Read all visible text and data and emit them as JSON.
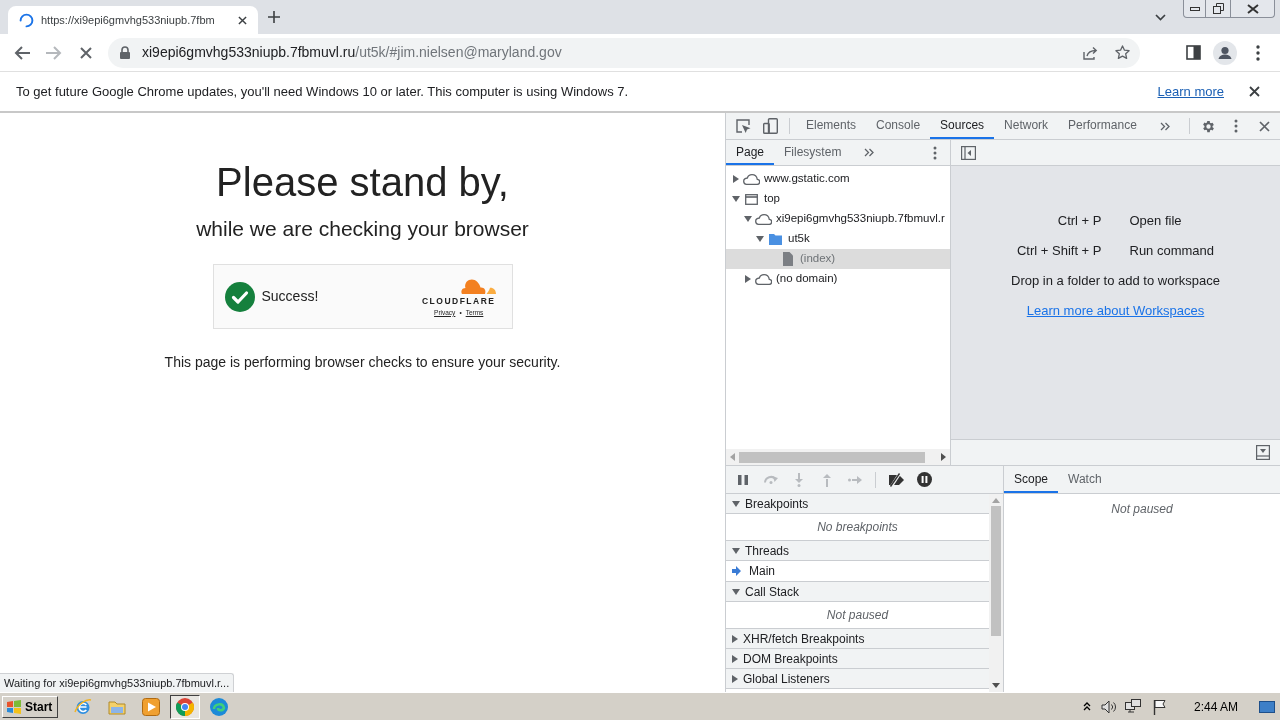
{
  "browser": {
    "tab": {
      "title": "https://xi9epi6gmvhg533niupb.7fbm",
      "loading": true
    },
    "nav_buttons": [
      {
        "kind": "back",
        "disabled": false
      },
      {
        "kind": "forward",
        "disabled": true
      },
      {
        "kind": "stop",
        "disabled": false
      }
    ],
    "address_bar": {
      "host": "xi9epi6gmvhg533niupb.7fbmuvl.ru",
      "path": "/ut5k/#jim.nielsen@maryland.gov"
    },
    "infobar": {
      "message": "To get future Google Chrome updates, you'll need Windows 10 or later. This computer is using Windows 7.",
      "link": "Learn more"
    },
    "status_bubble": "Waiting for xi9epi6gmvhg533niupb.7fbmuvl.r..."
  },
  "page": {
    "heading": "Please stand by,",
    "subheading": "while we are checking your browser",
    "widget": {
      "status": "Success!",
      "brand": "CLOUDFLARE",
      "links": [
        "Privacy",
        "Terms"
      ],
      "separator": "•"
    },
    "note": "This page is performing browser checks to ensure your security."
  },
  "devtools": {
    "tabs": [
      {
        "label": "Elements",
        "selected": false
      },
      {
        "label": "Console",
        "selected": false
      },
      {
        "label": "Sources",
        "selected": true
      },
      {
        "label": "Network",
        "selected": false
      },
      {
        "label": "Performance",
        "selected": false
      }
    ],
    "navigator": {
      "tabs": [
        {
          "label": "Page",
          "selected": true
        },
        {
          "label": "Filesystem",
          "selected": false
        }
      ],
      "tree": [
        {
          "label": "www.gstatic.com",
          "kind": "domain",
          "expanded": false,
          "selected": false
        },
        {
          "label": "top",
          "kind": "frame",
          "expanded": true,
          "selected": false,
          "children": [
            {
              "label": "xi9epi6gmvhg533niupb.7fbmuvl.r",
              "kind": "domain",
              "expanded": true,
              "selected": false,
              "children": [
                {
                  "label": "ut5k",
                  "kind": "folder",
                  "expanded": true,
                  "selected": false,
                  "children": [
                    {
                      "label": "(index)",
                      "kind": "file",
                      "selected": true
                    }
                  ]
                }
              ]
            },
            {
              "label": "(no domain)",
              "kind": "domain",
              "expanded": false,
              "selected": false
            }
          ]
        }
      ]
    },
    "editor": {
      "shortcuts": [
        {
          "keys": "Ctrl + P",
          "action": "Open file"
        },
        {
          "keys": "Ctrl + Shift + P",
          "action": "Run command"
        }
      ],
      "hint": "Drop in a folder to add to workspace",
      "link": "Learn more about Workspaces"
    },
    "debugger": {
      "toolbar": [
        {
          "kind": "pause",
          "disabled": false
        },
        {
          "kind": "step_over",
          "disabled": true
        },
        {
          "kind": "step_into",
          "disabled": true
        },
        {
          "kind": "step_out",
          "disabled": true
        },
        {
          "kind": "step",
          "disabled": true
        },
        {
          "kind": "deactivate_breakpoints",
          "disabled": false
        },
        {
          "kind": "pause_on_exceptions",
          "disabled": false
        }
      ],
      "sections": [
        {
          "title": "Breakpoints",
          "expanded": true,
          "empty_text": "No breakpoints"
        },
        {
          "title": "Threads",
          "expanded": true,
          "threads": [
            {
              "name": "Main",
              "selected": true
            }
          ]
        },
        {
          "title": "Call Stack",
          "expanded": true,
          "empty_text": "Not paused"
        },
        {
          "title": "XHR/fetch Breakpoints",
          "expanded": false
        },
        {
          "title": "DOM Breakpoints",
          "expanded": false
        },
        {
          "title": "Global Listeners",
          "expanded": false
        }
      ],
      "sidebar_tabs": [
        {
          "label": "Scope",
          "selected": true
        },
        {
          "label": "Watch",
          "selected": false
        }
      ],
      "sidebar_empty_text": "Not paused"
    }
  },
  "taskbar": {
    "start": "Start",
    "apps": [
      {
        "kind": "browser_e",
        "selected": false
      },
      {
        "kind": "folder",
        "selected": false
      },
      {
        "kind": "player",
        "selected": false
      },
      {
        "kind": "round_logo",
        "selected": true
      },
      {
        "kind": "swirl_logo",
        "selected": false
      }
    ],
    "clock": "2:44 AM"
  }
}
